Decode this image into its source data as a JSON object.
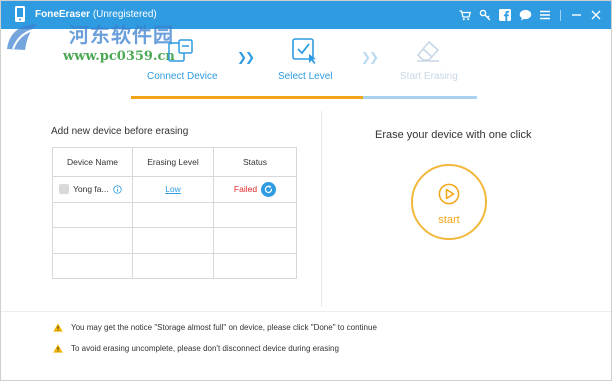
{
  "window": {
    "app_name": "FoneEraser",
    "registration": "(Unregistered)"
  },
  "titlebar": {
    "icons": [
      "cart-icon",
      "key-icon",
      "facebook-icon",
      "chat-icon",
      "menu-icon",
      "minimize-icon",
      "close-icon"
    ]
  },
  "watermark": {
    "chinese": "河东软件园",
    "url": "www.pc0359.cn"
  },
  "steps": [
    {
      "label": "Connect Device",
      "state": "done"
    },
    {
      "label": "Select Level",
      "state": "active"
    },
    {
      "label": "Start Erasing",
      "state": "pending"
    }
  ],
  "progress": {
    "fraction": 0.67
  },
  "left_panel": {
    "title": "Add new device before erasing",
    "columns": [
      "Device Name",
      "Erasing Level",
      "Status"
    ],
    "rows": [
      {
        "device": "Yong fa...",
        "level": "Low",
        "status": "Failed"
      }
    ]
  },
  "right_panel": {
    "title": "Erase your device with one click",
    "start_label": "start"
  },
  "notices": [
    "You may get the notice \"Storage almost full\" on device, please click \"Done\" to continue",
    "To avoid erasing uncomplete, please don't disconnect device during erasing"
  ],
  "colors": {
    "accent": "#2f9be0",
    "progress": "#f2a516",
    "failed": "#e02a2a",
    "start": "#f2b83c"
  }
}
